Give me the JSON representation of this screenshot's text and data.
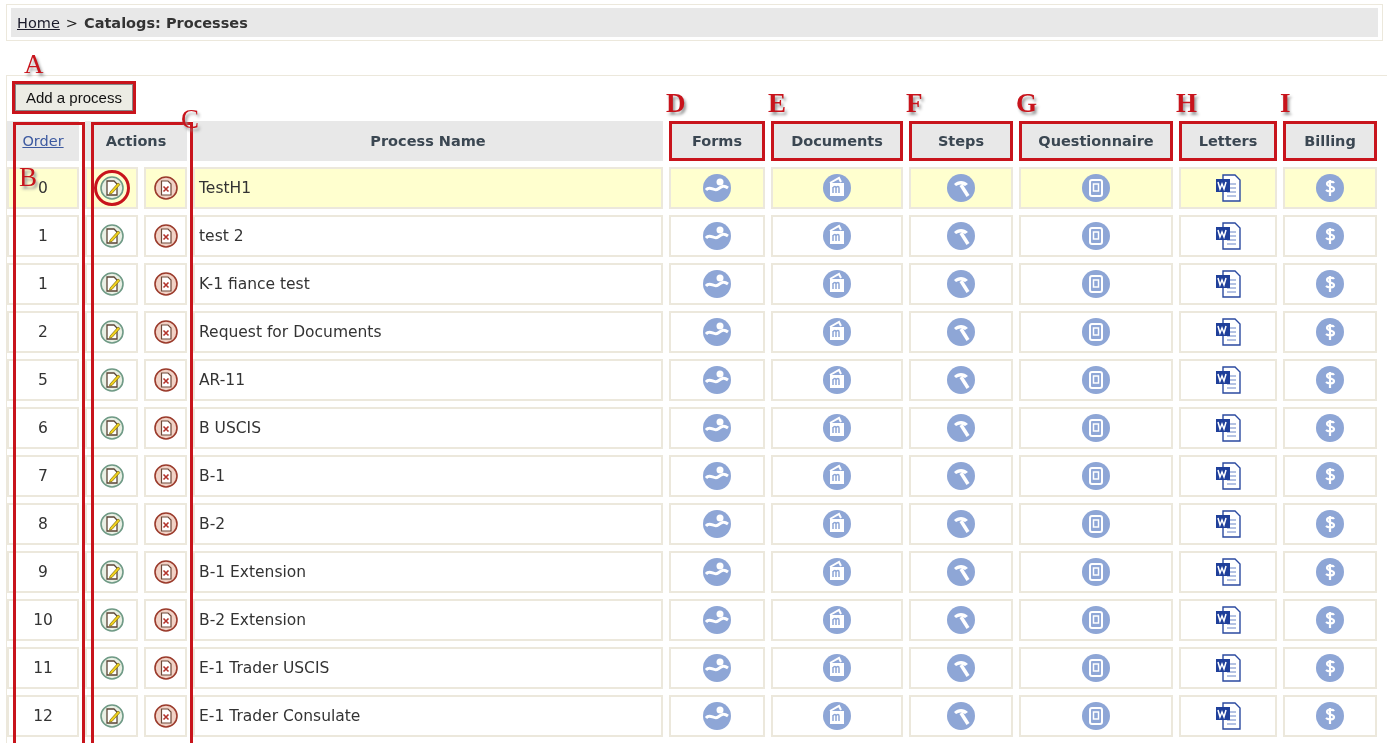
{
  "breadcrumb": {
    "link": "Home",
    "separator": ">",
    "current": "Catalogs: Processes"
  },
  "add_button": {
    "label": "Add a process",
    "annotation": "A"
  },
  "columns": [
    {
      "label": "Order",
      "kind": "link",
      "annotation": "B"
    },
    {
      "label": "Actions",
      "kind": "actions",
      "annotation": "C"
    },
    {
      "label": "Process Name",
      "kind": "text"
    },
    {
      "label": "Forms",
      "kind": "icon",
      "annotation": "D"
    },
    {
      "label": "Documents",
      "kind": "icon",
      "annotation": "E"
    },
    {
      "label": "Steps",
      "kind": "icon",
      "annotation": "F"
    },
    {
      "label": "Questionnaire",
      "kind": "icon",
      "annotation": "G"
    },
    {
      "label": "Letters",
      "kind": "icon",
      "annotation": "H"
    },
    {
      "label": "Billing",
      "kind": "icon",
      "annotation": "I"
    }
  ],
  "rows": [
    {
      "order": "0",
      "name": "TestH1",
      "selected": true,
      "circled": true
    },
    {
      "order": "1",
      "name": "test 2",
      "selected": false,
      "circled": false
    },
    {
      "order": "1",
      "name": "K-1 fiance test",
      "selected": false,
      "circled": false
    },
    {
      "order": "2",
      "name": "Request for Documents",
      "selected": false,
      "circled": false
    },
    {
      "order": "5",
      "name": "AR-11",
      "selected": false,
      "circled": false
    },
    {
      "order": "6",
      "name": "B USCIS",
      "selected": false,
      "circled": false
    },
    {
      "order": "7",
      "name": "B-1",
      "selected": false,
      "circled": false
    },
    {
      "order": "8",
      "name": "B-2",
      "selected": false,
      "circled": false
    },
    {
      "order": "9",
      "name": "B-1 Extension",
      "selected": false,
      "circled": false
    },
    {
      "order": "10",
      "name": "B-2 Extension",
      "selected": false,
      "circled": false
    },
    {
      "order": "11",
      "name": "E-1 Trader USCIS",
      "selected": false,
      "circled": false
    },
    {
      "order": "12",
      "name": "E-1 Trader Consulate",
      "selected": false,
      "circled": false
    }
  ]
}
